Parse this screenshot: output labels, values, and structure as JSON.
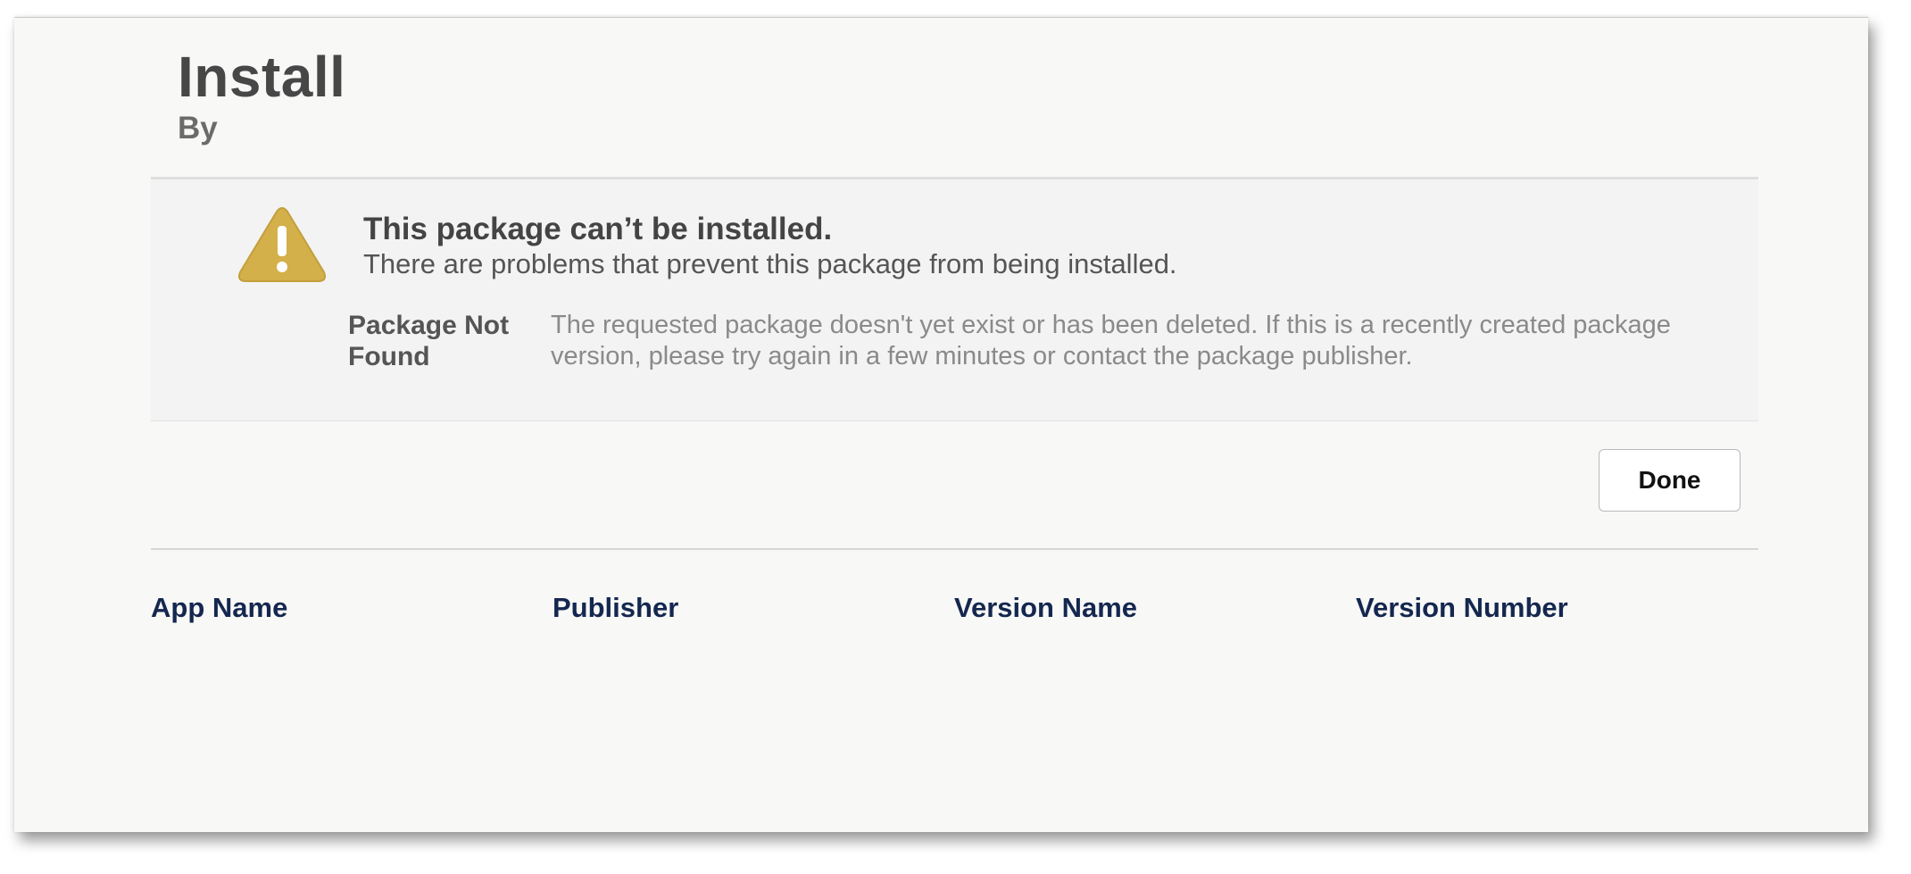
{
  "header": {
    "title": "Install",
    "byline": "By"
  },
  "error": {
    "icon": "warning-icon",
    "icon_color": "#d4b04a",
    "heading": "This package can’t be installed.",
    "subheading": "There are problems that prevent this package from being installed.",
    "detail_label": "Package Not Found",
    "detail_text": "The requested package doesn't yet exist or has been deleted. If this is a recently created package version, please try again in a few minutes or contact the package publisher."
  },
  "actions": {
    "done_label": "Done"
  },
  "table": {
    "columns": [
      "App Name",
      "Publisher",
      "Version Name",
      "Version Number"
    ],
    "header_color": "#14274f",
    "rows": []
  }
}
